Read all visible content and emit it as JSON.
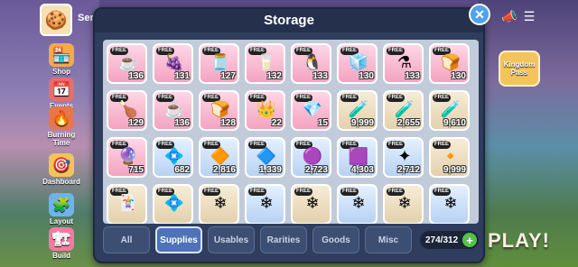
{
  "background": {
    "player_name": "Sera",
    "sidebar": [
      {
        "label": "Shop",
        "icon": "shop-icon",
        "glyph": "🏪"
      },
      {
        "label": "Events",
        "icon": "events-icon",
        "glyph": "📅"
      },
      {
        "label": "Burning Time",
        "icon": "flame-icon",
        "glyph": "🔥"
      },
      {
        "label": "Dashboard",
        "icon": "dashboard-icon",
        "glyph": "🎯"
      },
      {
        "label": "Layout",
        "icon": "layout-icon",
        "glyph": "🧩"
      },
      {
        "label": "Build",
        "icon": "build-icon",
        "glyph": "🏗"
      }
    ],
    "kingdom_pass": "Kingdom Pass",
    "play_label": "PLAY!"
  },
  "storage": {
    "title": "Storage",
    "close_glyph": "✕",
    "free_badge": "FREE",
    "items": [
      {
        "icon": "coffee-icon",
        "glyph": "☕",
        "count": "136",
        "rarity": "pink"
      },
      {
        "icon": "jelly-icon",
        "glyph": "🍇",
        "count": "131",
        "rarity": "pink"
      },
      {
        "icon": "jam-jar-icon",
        "glyph": "🫙",
        "count": "127",
        "rarity": "pink"
      },
      {
        "icon": "milk-jar-icon",
        "glyph": "🥛",
        "count": "132",
        "rarity": "pink"
      },
      {
        "icon": "penguin-icon",
        "glyph": "🐧",
        "count": "133",
        "rarity": "pink"
      },
      {
        "icon": "sugar-cube-icon",
        "glyph": "🧊",
        "count": "130",
        "rarity": "pink"
      },
      {
        "icon": "flask-icon",
        "glyph": "⚗",
        "count": "133",
        "rarity": "pink"
      },
      {
        "icon": "bread-icon",
        "glyph": "🍞",
        "count": "130",
        "rarity": "pink"
      },
      {
        "icon": "roast-icon",
        "glyph": "🍗",
        "count": "129",
        "rarity": "pink"
      },
      {
        "icon": "latte-icon",
        "glyph": "☕",
        "count": "136",
        "rarity": "pink"
      },
      {
        "icon": "toast-icon",
        "glyph": "🍞",
        "count": "128",
        "rarity": "pink"
      },
      {
        "icon": "crown-icon",
        "glyph": "👑",
        "count": "22",
        "rarity": "pink"
      },
      {
        "icon": "gem-icon",
        "glyph": "💎",
        "count": "15",
        "rarity": "pink"
      },
      {
        "icon": "potion-icon",
        "glyph": "🧪",
        "count": "9,999",
        "rarity": "tan"
      },
      {
        "icon": "potion-icon",
        "glyph": "🧪",
        "count": "2,655",
        "rarity": "tan"
      },
      {
        "icon": "potion-icon",
        "glyph": "🧪",
        "count": "9,610",
        "rarity": "tan"
      },
      {
        "icon": "crystal-icon",
        "glyph": "🔮",
        "count": "715",
        "rarity": "pink"
      },
      {
        "icon": "crystal-icon",
        "glyph": "💠",
        "count": "682",
        "rarity": "blue"
      },
      {
        "icon": "gem-icon",
        "glyph": "🔶",
        "count": "2,816",
        "rarity": "blue"
      },
      {
        "icon": "gem-icon",
        "glyph": "🔷",
        "count": "1,339",
        "rarity": "blue"
      },
      {
        "icon": "gem-icon",
        "glyph": "🟣",
        "count": "2,723",
        "rarity": "blue"
      },
      {
        "icon": "gem-icon",
        "glyph": "🟪",
        "count": "4,303",
        "rarity": "blue"
      },
      {
        "icon": "star-icon",
        "glyph": "✦",
        "count": "2,712",
        "rarity": "blue"
      },
      {
        "icon": "crystal-icon",
        "glyph": "🔸",
        "count": "9,999",
        "rarity": "tan"
      },
      {
        "icon": "card-icon",
        "glyph": "🃏",
        "count": "",
        "rarity": "tan"
      },
      {
        "icon": "crystal-icon",
        "glyph": "💠",
        "count": "",
        "rarity": "tan"
      },
      {
        "icon": "snowflake-icon",
        "glyph": "❄",
        "count": "",
        "rarity": "tan"
      },
      {
        "icon": "snowflake-icon",
        "glyph": "❄",
        "count": "",
        "rarity": "blue"
      },
      {
        "icon": "snowflake-icon",
        "glyph": "❄",
        "count": "",
        "rarity": "tan"
      },
      {
        "icon": "snowflake-icon",
        "glyph": "❄",
        "count": "",
        "rarity": "blue"
      },
      {
        "icon": "snowflake-icon",
        "glyph": "❄",
        "count": "",
        "rarity": "tan"
      },
      {
        "icon": "snowflake-icon",
        "glyph": "❄",
        "count": "",
        "rarity": "blue"
      }
    ],
    "tabs": [
      {
        "label": "All",
        "active": false
      },
      {
        "label": "Supplies",
        "active": true
      },
      {
        "label": "Usables",
        "active": false
      },
      {
        "label": "Rarities",
        "active": false
      },
      {
        "label": "Goods",
        "active": false
      },
      {
        "label": "Misc",
        "active": false
      }
    ],
    "capacity": "274/312",
    "add_glyph": "+"
  },
  "colors": {
    "accent": "#4f73b8",
    "panel": "#2f3e5e",
    "add": "#56c04b"
  }
}
